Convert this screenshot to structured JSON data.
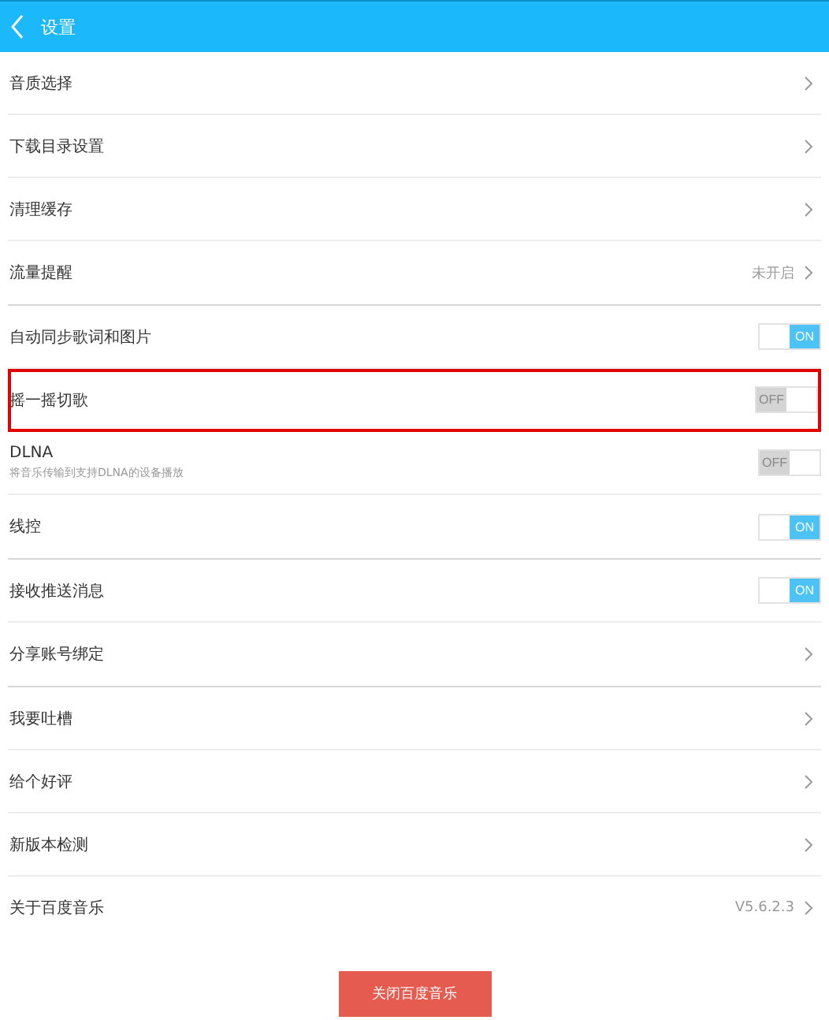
{
  "header": {
    "title": "设置"
  },
  "groups": [
    {
      "items": [
        {
          "kind": "link",
          "label": "音质选择"
        },
        {
          "kind": "link",
          "label": "下载目录设置"
        },
        {
          "kind": "link",
          "label": "清理缓存"
        },
        {
          "kind": "link",
          "label": "流量提醒",
          "value": "未开启"
        }
      ]
    },
    {
      "items": [
        {
          "kind": "toggle",
          "label": "自动同步歌词和图片",
          "on": true,
          "switch_text": "ON",
          "highlighted": false
        },
        {
          "kind": "toggle",
          "label": "摇一摇切歌",
          "on": false,
          "switch_text": "OFF",
          "highlighted": true
        },
        {
          "kind": "toggle",
          "label": "DLNA",
          "subtitle": "将音乐传输到支持DLNA的设备播放",
          "on": false,
          "switch_text": "OFF",
          "highlighted": false
        },
        {
          "kind": "toggle",
          "label": "线控",
          "on": true,
          "switch_text": "ON",
          "highlighted": false
        }
      ]
    },
    {
      "items": [
        {
          "kind": "toggle",
          "label": "接收推送消息",
          "on": true,
          "switch_text": "ON",
          "highlighted": false
        },
        {
          "kind": "link",
          "label": "分享账号绑定"
        }
      ]
    },
    {
      "items": [
        {
          "kind": "link",
          "label": "我要吐槽"
        },
        {
          "kind": "link",
          "label": "给个好评"
        },
        {
          "kind": "link",
          "label": "新版本检测"
        },
        {
          "kind": "link",
          "label": "关于百度音乐",
          "value": "V5.6.2.3"
        }
      ]
    }
  ],
  "exit_button": "关闭百度音乐"
}
